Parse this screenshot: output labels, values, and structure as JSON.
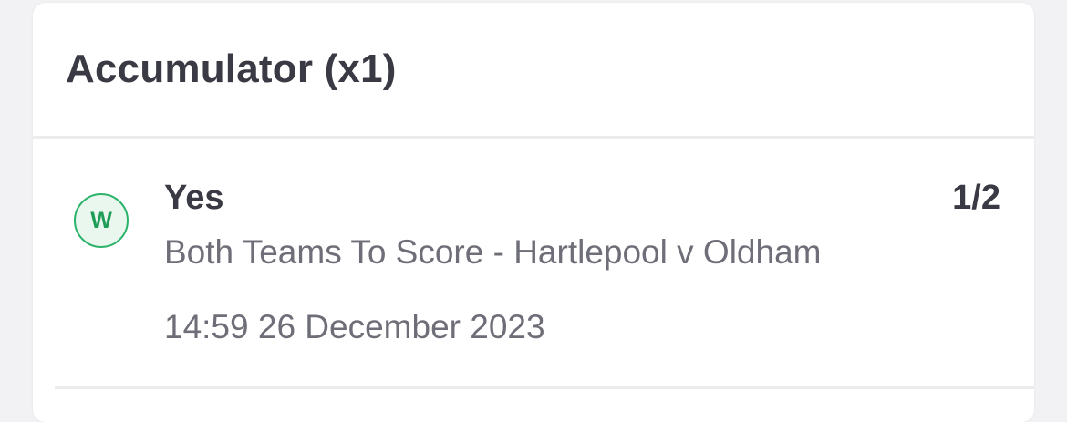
{
  "card": {
    "title": "Accumulator (x1)"
  },
  "selection": {
    "result_badge": "W",
    "name": "Yes",
    "odds": "1/2",
    "market_event": "Both Teams To Score - Hartlepool v Oldham",
    "datetime": "14:59 26 December 2023"
  },
  "colors": {
    "win_green": "#2bb36a",
    "title_text": "#3a3a44",
    "secondary_text": "#6e6e78"
  }
}
